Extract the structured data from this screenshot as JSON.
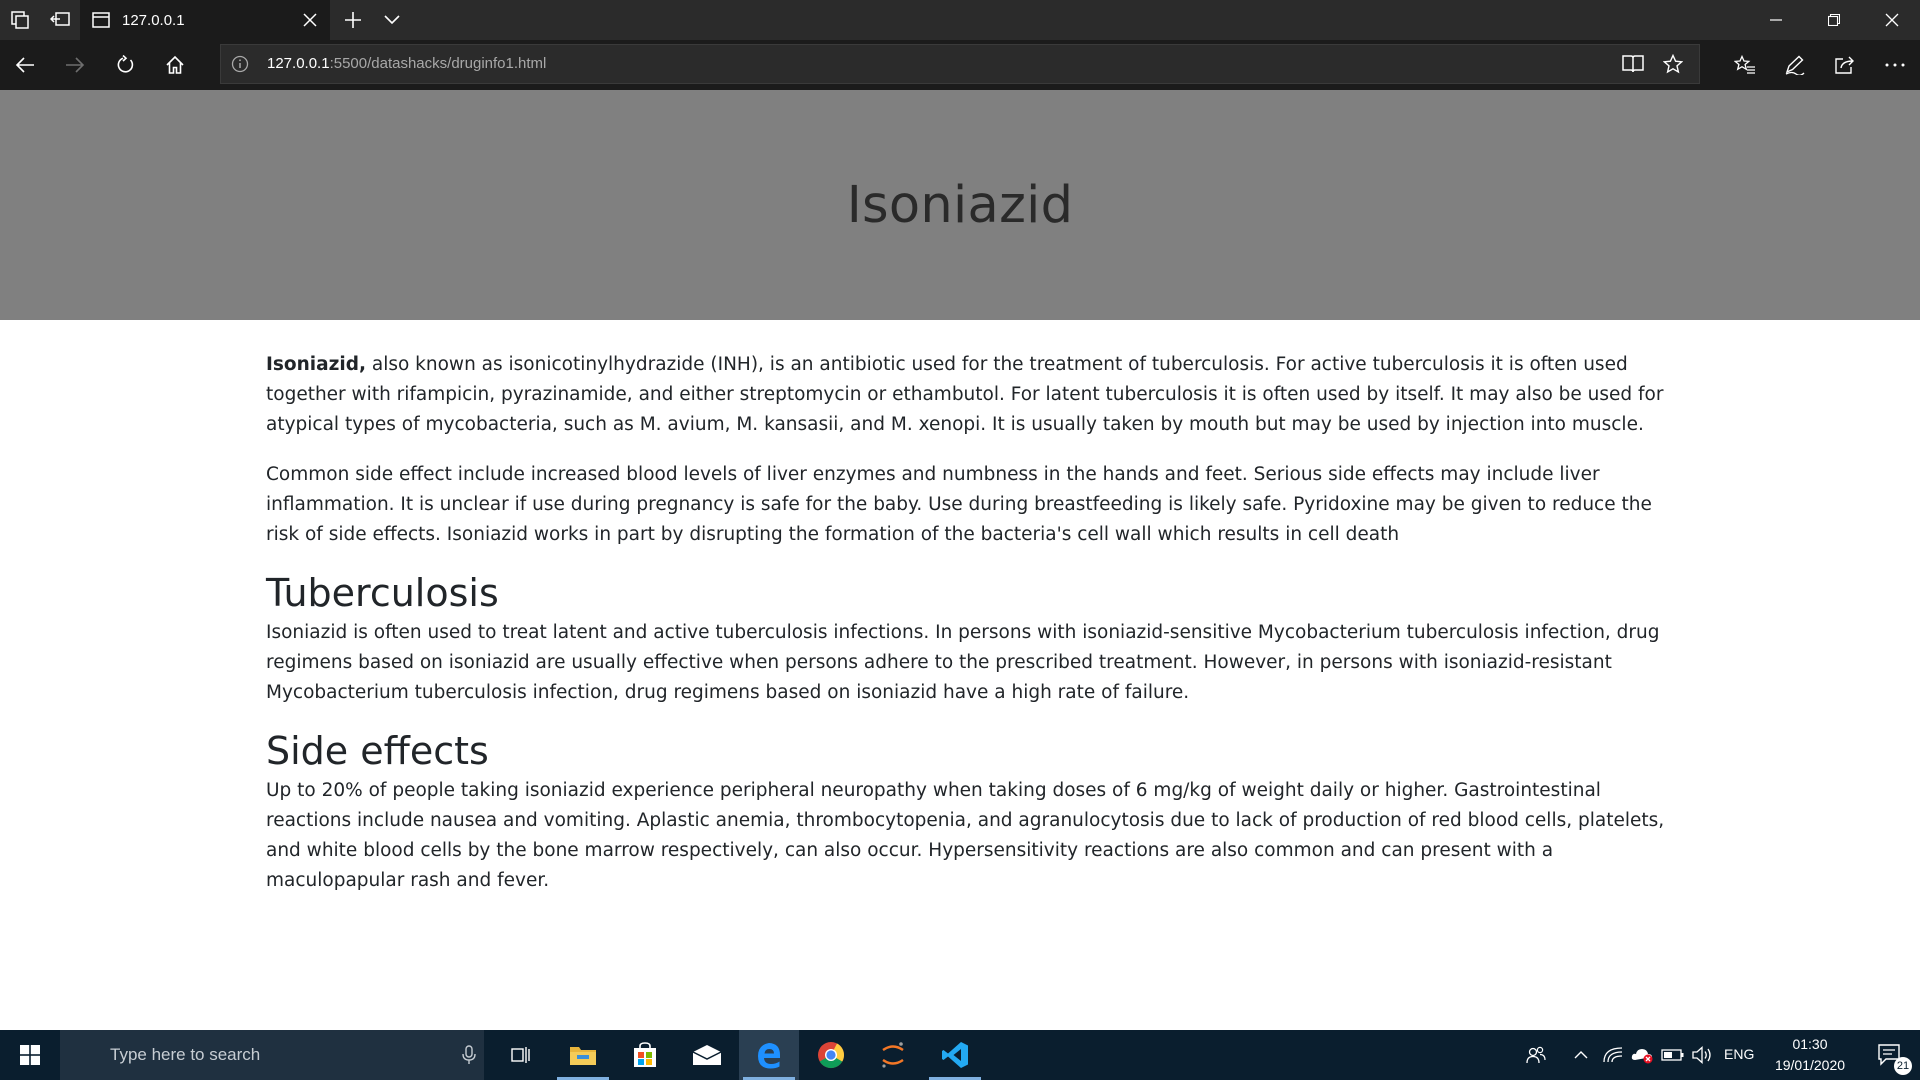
{
  "browser": {
    "tab_title": "127.0.0.1",
    "url_host": "127.0.0.1",
    "url_path": ":5500/datashacks/druginfo1.html"
  },
  "page": {
    "title": "Isoniazid",
    "intro_bold": "Isoniazid,",
    "intro_rest": " also known as isonicotinylhydrazide (INH), is an antibiotic used for the treatment of tuberculosis. For active tuberculosis it is often used together with rifampicin, pyrazinamide, and either streptomycin or ethambutol. For latent tuberculosis it is often used by itself. It may also be used for atypical types of mycobacteria, such as M. avium, M. kansasii, and M. xenopi. It is usually taken by mouth but may be used by injection into muscle.",
    "para2": "Common side effect include increased blood levels of liver enzymes and numbness in the hands and feet. Serious side effects may include liver inflammation. It is unclear if use during pregnancy is safe for the baby. Use during breastfeeding is likely safe. Pyridoxine may be given to reduce the risk of side effects. Isoniazid works in part by disrupting the formation of the bacteria's cell wall which results in cell death",
    "section1_heading": "Tuberculosis",
    "section1_text": "Isoniazid is often used to treat latent and active tuberculosis infections. In persons with isoniazid-sensitive Mycobacterium tuberculosis infection, drug regimens based on isoniazid are usually effective when persons adhere to the prescribed treatment. However, in persons with isoniazid-resistant Mycobacterium tuberculosis infection, drug regimens based on isoniazid have a high rate of failure.",
    "section2_heading": "Side effects",
    "section2_text": "Up to 20% of people taking isoniazid experience peripheral neuropathy when taking doses of 6 mg/kg of weight daily or higher. Gastrointestinal reactions include nausea and vomiting. Aplastic anemia, thrombocytopenia, and agranulocytosis due to lack of production of red blood cells, platelets, and white blood cells by the bone marrow respectively, can also occur. Hypersensitivity reactions are also common and can present with a maculopapular rash and fever."
  },
  "taskbar": {
    "search_placeholder": "Type here to search",
    "language": "ENG",
    "time": "01:30",
    "date": "19/01/2020",
    "notification_count": "21"
  },
  "colors": {
    "header_bg": "#808080",
    "taskbar_bg": "#0a1e2e",
    "browser_chrome": "#2b2b2b"
  }
}
